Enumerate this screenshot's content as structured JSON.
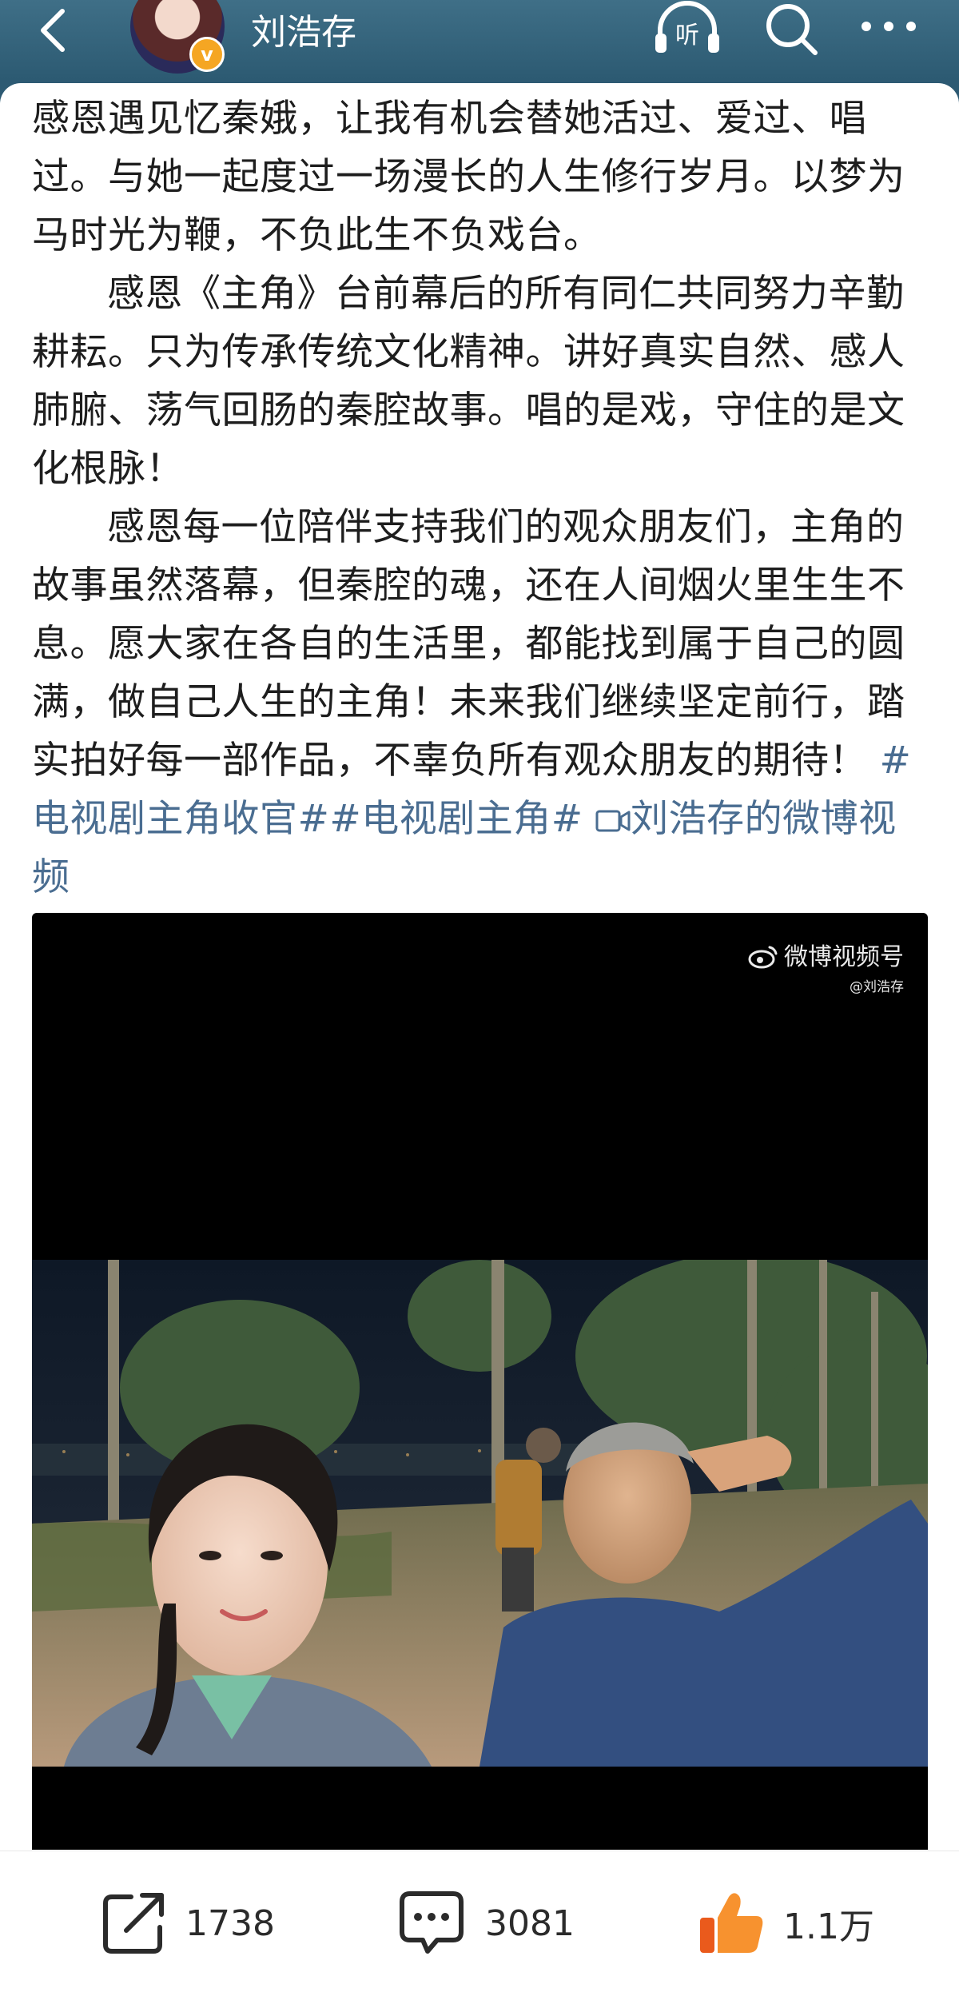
{
  "header": {
    "username": "刘浩存",
    "verified_badge": "v",
    "icons": [
      "back-icon",
      "listen-icon",
      "search-icon",
      "more-icon"
    ],
    "listen_label": "听"
  },
  "post": {
    "paragraphs": [
      "感恩遇见忆秦娥，让我有机会替她活过、爱过、唱过。与她一起度过一场漫长的人生修行岁月。以梦为马时光为鞭，不负此生不负戏台。",
      "感恩《主角》台前幕后的所有同仁共同努力辛勤耕耘。只为传承传统文化精神。讲好真实自然、感人肺腑、荡气回肠的秦腔故事。唱的是戏，守住的是文化根脉！",
      "感恩每一位陪伴支持我们的观众朋友们，主角的故事虽然落幕，但秦腔的魂，还在人间烟火里生生不息。愿大家在各自的生活里，都能找到属于自己的圆满，做自己人生的主角！未来我们继续坚定前行，踏实拍好每一部作品，不辜负所有观众朋友的期待！"
    ],
    "hashtag1": "#电视剧主角收官#",
    "hashtag2": "#电视剧主角#",
    "video_link": "刘浩存的微博视频"
  },
  "video": {
    "watermark_title": "微博视频号",
    "watermark_sub": "@刘浩存"
  },
  "actions": {
    "share_count": "1738",
    "comment_count": "3081",
    "like_count": "1.1万"
  },
  "colors": {
    "header_bg": "#2d5a73",
    "link": "#4a6d91",
    "like_orange": "#f57d2c"
  }
}
